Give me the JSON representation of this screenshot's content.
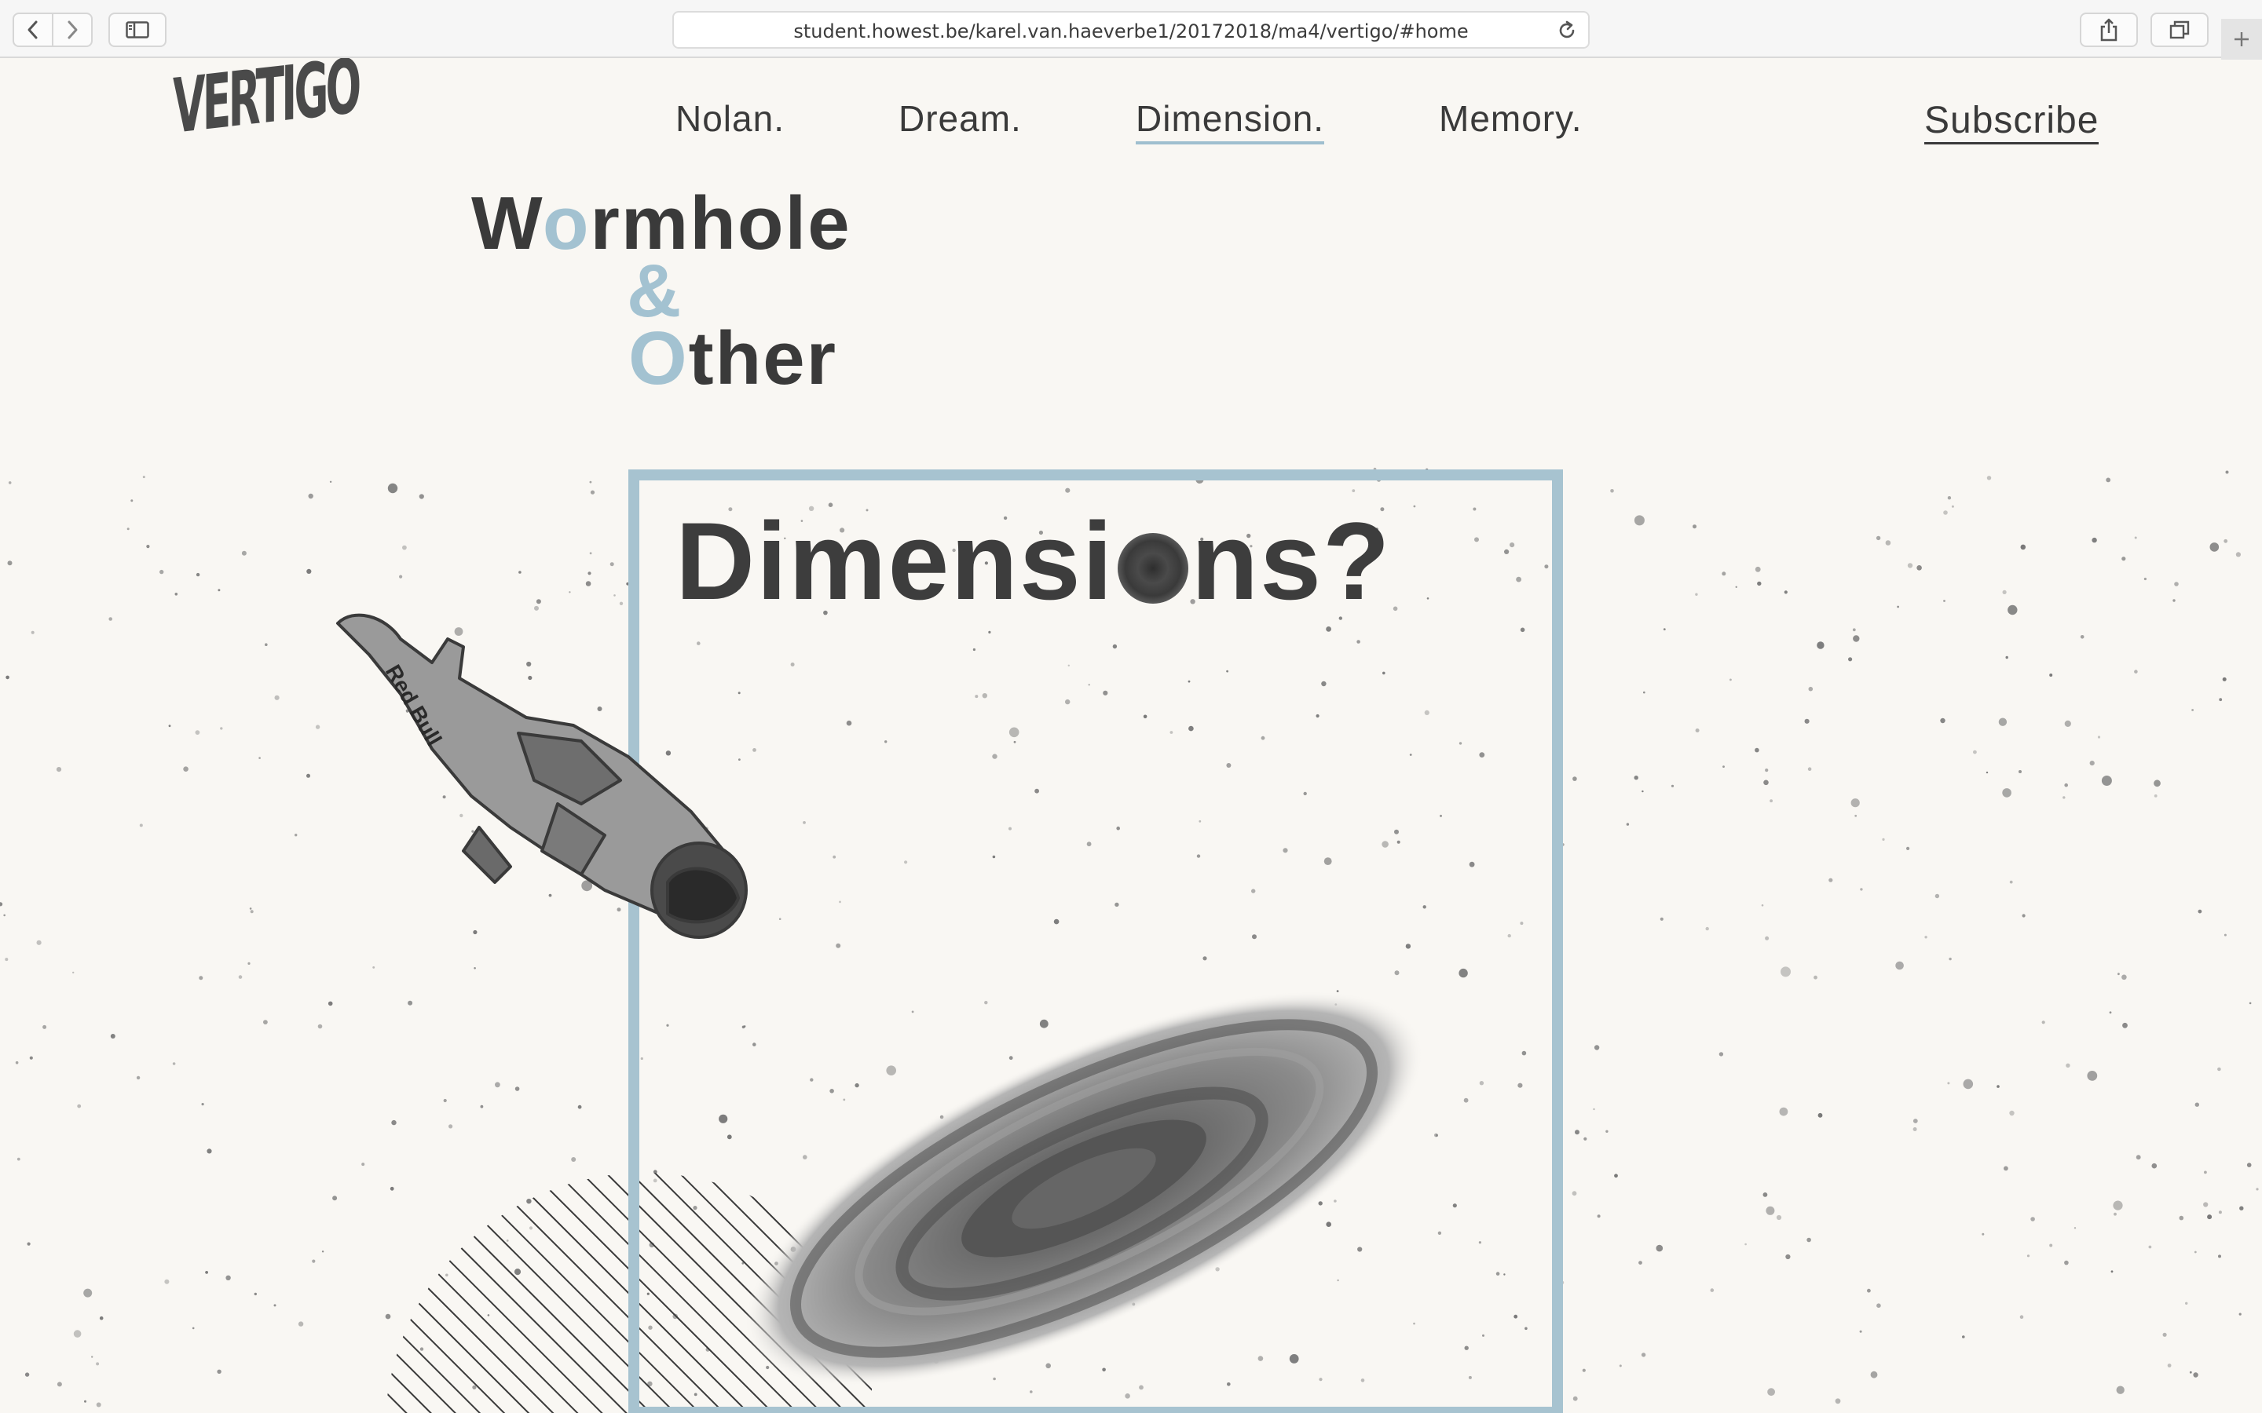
{
  "browser": {
    "url": "student.howest.be/karel.van.haeverbe1/20172018/ma4/vertigo/#home",
    "icons": {
      "back": "chevron-left-icon",
      "forward": "chevron-right-icon",
      "sidebar": "sidebar-icon",
      "reload": "reload-icon",
      "share": "share-icon",
      "tabs": "tabs-icon",
      "new_tab": "plus-icon"
    }
  },
  "site": {
    "logo": "VERTIGO",
    "nav": [
      {
        "label": "Nolan.",
        "active": false
      },
      {
        "label": "Dream.",
        "active": false
      },
      {
        "label": "Dimension.",
        "active": true
      },
      {
        "label": "Memory.",
        "active": false
      }
    ],
    "subscribe": "Subscribe"
  },
  "hero": {
    "line1_a": "W",
    "line1_accent": "o",
    "line1_b": "rmhole",
    "line2": "&",
    "line3_accent": "O",
    "line3_b": "ther"
  },
  "feature": {
    "title_a": "Dimensi",
    "title_b": "ns?",
    "o_icon": "wormhole-icon"
  },
  "colors": {
    "accent": "#a3c2d1",
    "frame": "#a7c3d0",
    "text": "#3a3a3a",
    "background": "#f9f7f3"
  }
}
